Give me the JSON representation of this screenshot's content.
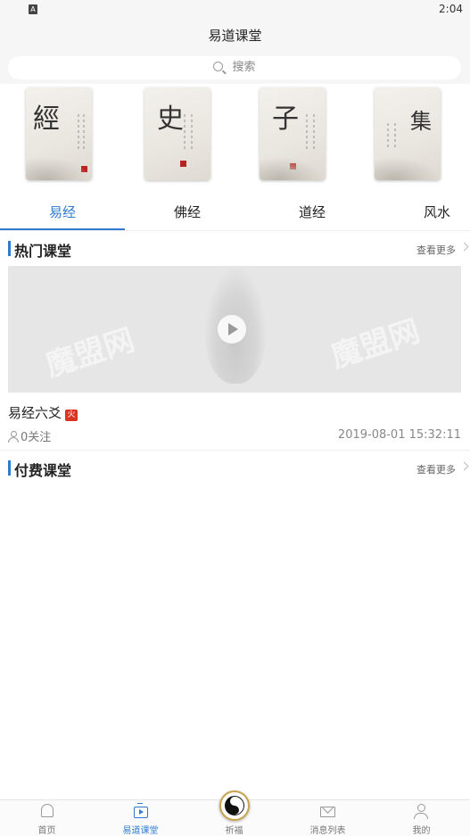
{
  "status_bar": {
    "indicator": "A",
    "time": "2:04"
  },
  "header": {
    "title": "易道课堂"
  },
  "search": {
    "placeholder": "搜索"
  },
  "covers": [
    {
      "char": "經",
      "icon": "jing-cover"
    },
    {
      "char": "史",
      "icon": "shi-cover"
    },
    {
      "char": "子",
      "icon": "zi-cover"
    },
    {
      "char": "集",
      "icon": "ji-cover"
    }
  ],
  "tabs": [
    {
      "label": "易经",
      "active": true
    },
    {
      "label": "佛经",
      "active": false
    },
    {
      "label": "道经",
      "active": false
    },
    {
      "label": "风水",
      "active": false
    }
  ],
  "hot_section": {
    "title": "热门课堂",
    "more": "查看更多"
  },
  "video": {
    "watermark": "魔盟网"
  },
  "course": {
    "title": "易经六爻",
    "badge": "火",
    "follow": "0关注",
    "time": "2019-08-01 15:32:11"
  },
  "paid_section": {
    "title": "付费课堂",
    "more": "查看更多"
  },
  "nav": [
    {
      "label": "首页",
      "icon": "home-icon",
      "active": false
    },
    {
      "label": "易道课堂",
      "icon": "classroom-icon",
      "active": true
    },
    {
      "label": "祈福",
      "icon": "taichi-icon",
      "active": false
    },
    {
      "label": "消息列表",
      "icon": "mail-icon",
      "active": false
    },
    {
      "label": "我的",
      "icon": "profile-icon",
      "active": false
    }
  ],
  "colors": {
    "accent": "#2f7bd2",
    "badge": "#dd3322"
  }
}
